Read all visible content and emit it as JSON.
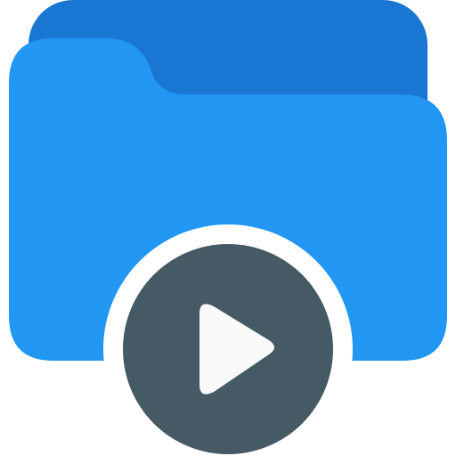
{
  "icon": {
    "name": "video-folder-icon",
    "parts": {
      "folder": "folder-icon",
      "play": "play-icon"
    },
    "colors": {
      "background": "#ffffff",
      "folder_back": "#1976d2",
      "folder_front": "#2196f3",
      "play_ring": "#ffffff",
      "play_circle": "#455a64",
      "play_triangle": "#fafafa"
    }
  }
}
